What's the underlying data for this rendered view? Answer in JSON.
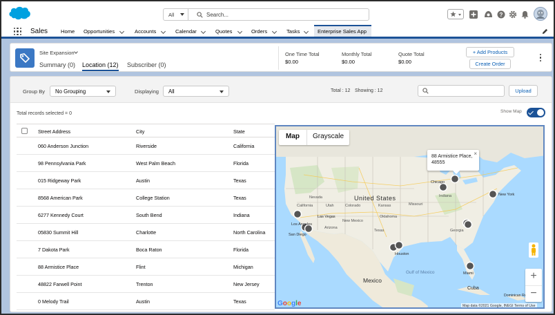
{
  "global_header": {
    "search_scope": "All",
    "search_placeholder": "Search..."
  },
  "app_nav": {
    "app_name": "Sales",
    "items": [
      {
        "label": "Home",
        "has_menu": false
      },
      {
        "label": "Opportunities",
        "has_menu": true
      },
      {
        "label": "Accounts",
        "has_menu": true
      },
      {
        "label": "Calendar",
        "has_menu": true
      },
      {
        "label": "Quotes",
        "has_menu": true
      },
      {
        "label": "Orders",
        "has_menu": true
      },
      {
        "label": "Tasks",
        "has_menu": true
      }
    ],
    "active_tab": "Enterprise Sales App"
  },
  "record": {
    "title": "Site Expansion",
    "tabs": [
      {
        "label": "Summary (0)",
        "active": false
      },
      {
        "label": "Location (12)",
        "active": true
      },
      {
        "label": "Subscriber (0)",
        "active": false
      }
    ],
    "summary": [
      {
        "label": "One Time Total",
        "value": "$0.00"
      },
      {
        "label": "Monthly Total",
        "value": "$0.00"
      },
      {
        "label": "Quote Total",
        "value": "$0.00"
      }
    ],
    "add_products_label": "+ Add Products",
    "create_order_label": "Create Order"
  },
  "filters": {
    "group_by_label": "Group By",
    "group_by_value": "No Grouping",
    "displaying_label": "Displaying",
    "displaying_value": "All",
    "total_text": "Total : 12",
    "showing_text": "Showing : 12",
    "upload_label": "Upload"
  },
  "selection": {
    "text": "Total records selected = 0",
    "show_map_label": "Show Map",
    "show_map_on": true
  },
  "table": {
    "headers": [
      "Street Address",
      "City",
      "State"
    ],
    "rows": [
      [
        "060 Anderson Junction",
        "Riverside",
        "California"
      ],
      [
        "98 Pennsylvania Park",
        "West Palm Beach",
        "Florida"
      ],
      [
        "015 Ridgeway Park",
        "Austin",
        "Texas"
      ],
      [
        "8568 American Park",
        "College Station",
        "Texas"
      ],
      [
        "6277 Kennedy Court",
        "South Bend",
        "Indiana"
      ],
      [
        "05830 Summit Hill",
        "Charlotte",
        "North Carolina"
      ],
      [
        "7 Dakota Park",
        "Boca Raton",
        "Florida"
      ],
      [
        "88 Armistice Place",
        "Flint",
        "Michigan"
      ],
      [
        "48822 Farwell Point",
        "Trenton",
        "New Jersey"
      ],
      [
        "0 Melody Trail",
        "Austin",
        "Texas"
      ]
    ]
  },
  "map": {
    "tab_map": "Map",
    "tab_grayscale": "Grayscale",
    "popup_line1": "88 Armistice Place,",
    "popup_line2": "48555",
    "attribution": "Map data ©2021 Google, INEGI   Terms of Use",
    "zoom_in": "+",
    "zoom_out": "−",
    "labels": {
      "country_us": "United States",
      "mexico": "Mexico",
      "cuba": "Cuba",
      "la": "Los Angeles",
      "lv": "Las Vegas",
      "sd": "San Diego",
      "houston": "Houston",
      "chicago": "Chicago",
      "ny": "New York",
      "miami": "Miami",
      "dominican": "Dominican Republic",
      "california": "California",
      "arizona": "Arizona",
      "texas": "Texas",
      "colorado": "Colorado",
      "utah": "Utah",
      "nevada": "Nevada",
      "newmexico": "New Mexico",
      "oklahoma": "Oklahoma",
      "kansas": "Kansas",
      "missouri": "Missouri",
      "georgia": "Georgia",
      "indiana": "Indiana",
      "gulf": "Gulf of Mexico"
    },
    "google": "Google"
  }
}
